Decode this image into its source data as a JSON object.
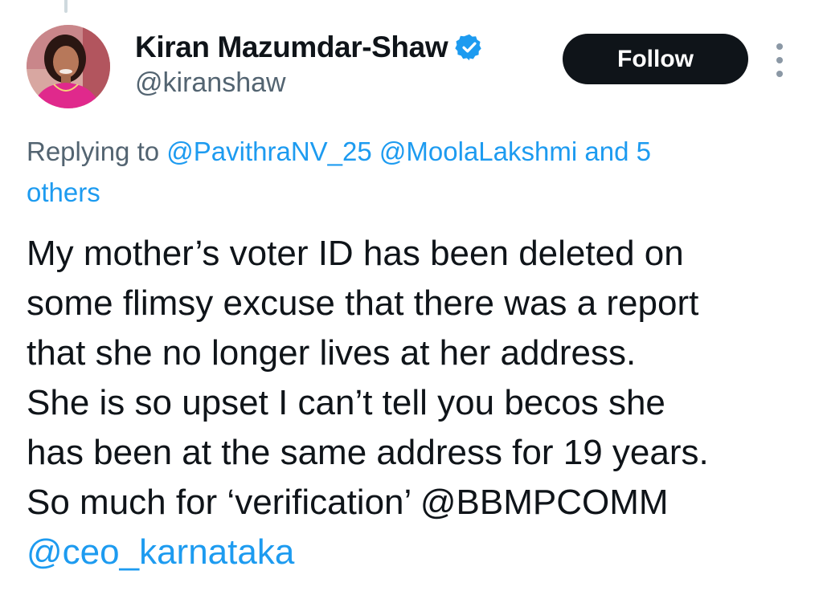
{
  "author": {
    "display_name": "Kiran Mazumdar-Shaw",
    "handle": "@kiranshaw",
    "verified": true,
    "verified_icon": "verified-badge-icon",
    "verified_color": "#1d9bf0"
  },
  "actions": {
    "follow_label": "Follow",
    "more_icon": "more-vertical-icon"
  },
  "reply_context": {
    "prefix": "Replying to",
    "mention_1": "@PavithraNV_25",
    "mention_2": "@MoolaLakshmi",
    "others_first": "and 5",
    "others_second": "others"
  },
  "tweet": {
    "lines": [
      "My mother’s voter ID has been deleted on",
      "some flimsy excuse that there was a report",
      "that she no longer lives at her address.",
      "She is so upset I can’t tell you becos she",
      "has been at the same address for 19 years.",
      "So much for ‘verification’ @BBMPCOMM"
    ],
    "last_line_mention": "@ceo_karnataka"
  },
  "colors": {
    "text": "#0f1419",
    "secondary_text": "#536471",
    "link": "#1d9bf0",
    "follow_button_bg": "#0f1419",
    "follow_button_text": "#ffffff"
  }
}
